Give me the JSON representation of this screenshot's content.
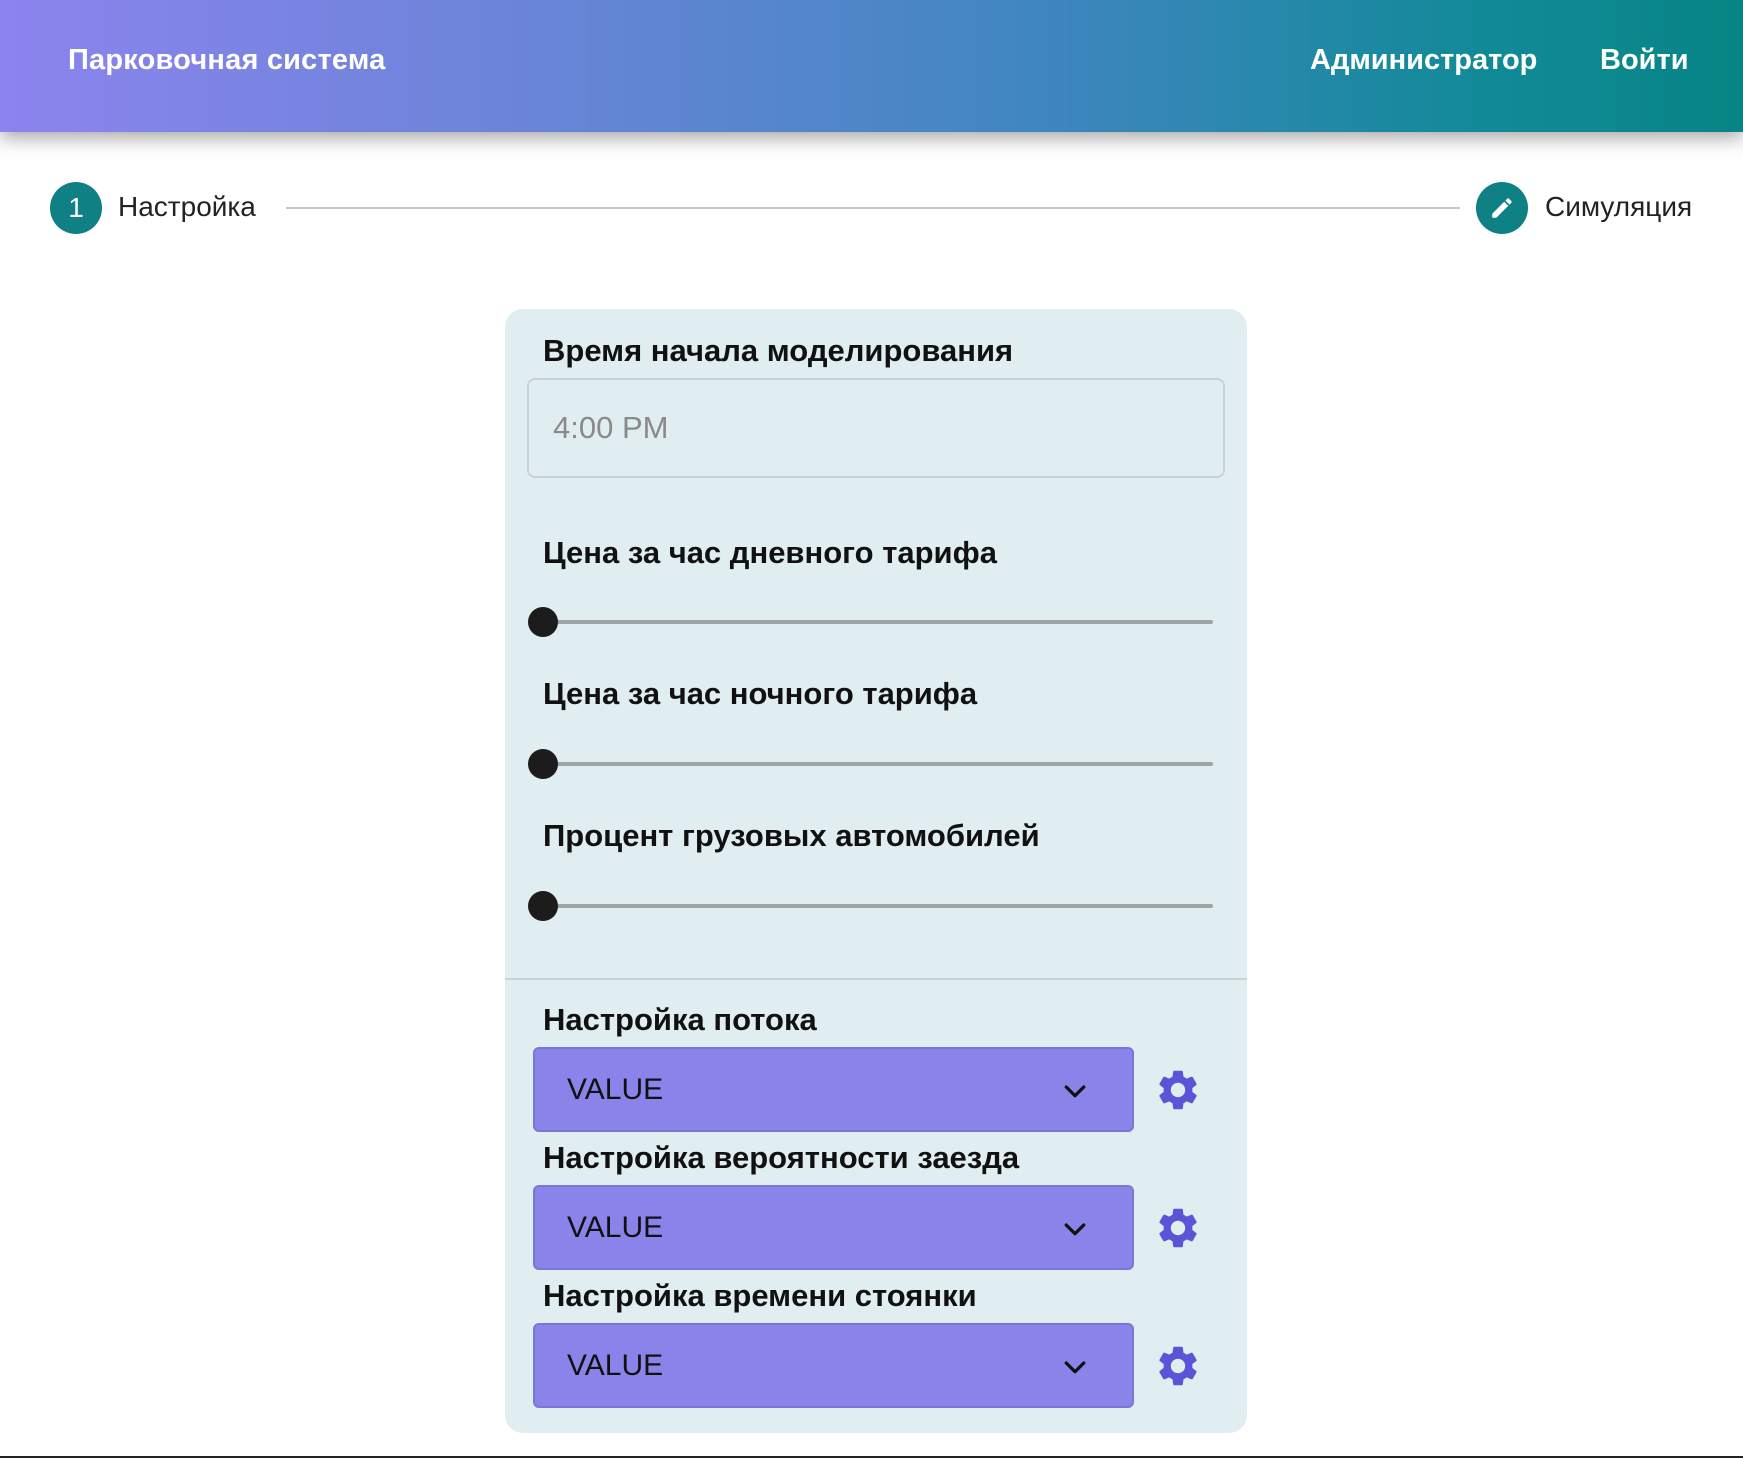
{
  "header": {
    "brand": "Парковочная система",
    "nav": {
      "admin": "Администратор",
      "login": "Войти"
    }
  },
  "stepper": {
    "steps": [
      {
        "number": "1",
        "label": "Настройка",
        "icon": "number"
      },
      {
        "label": "Симуляция",
        "icon": "pencil-icon"
      }
    ]
  },
  "form": {
    "start_time": {
      "label": "Время начала моделирования",
      "value": "4:00 PM"
    },
    "day_price": {
      "label": "Цена за час дневного тарифа",
      "value_fraction": 0
    },
    "night_price": {
      "label": "Цена за час ночного тарифа",
      "value_fraction": 0
    },
    "truck_percent": {
      "label": "Процент грузовых автомобилей",
      "value_fraction": 0
    },
    "flow": {
      "label": "Настройка потока",
      "selected": "VALUE"
    },
    "entry_probability": {
      "label": "Настройка вероятности заезда",
      "selected": "VALUE"
    },
    "parking_time": {
      "label": "Настройка времени стоянки",
      "selected": "VALUE"
    }
  },
  "colors": {
    "accent": "#0f8083",
    "select_bg": "#8a83ea",
    "gear": "#5a54d6",
    "card_bg": "#e0eef1"
  }
}
